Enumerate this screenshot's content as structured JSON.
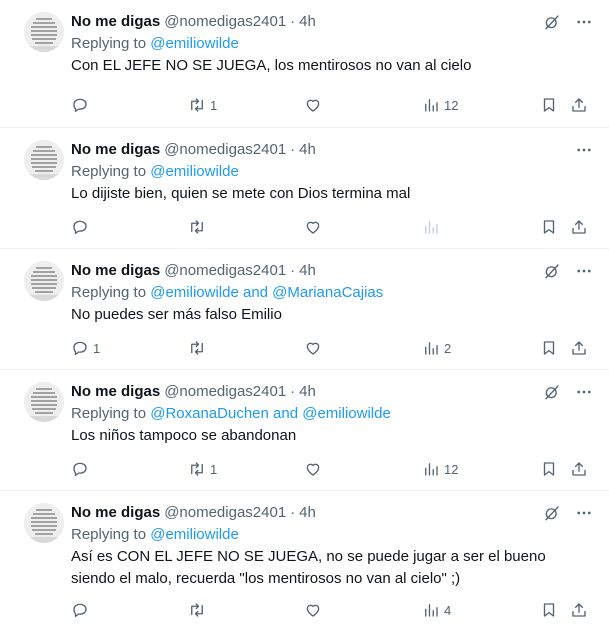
{
  "tweets": [
    {
      "name": "No me digas",
      "handle": "@nomedigas2401",
      "time": "4h",
      "replying_prefix": "Replying to ",
      "mentions": "@emiliowilde",
      "text": "Con EL JEFE NO SE JUEGA, los mentirosos no van al cielo",
      "reply_count": "",
      "retweet_count": "1",
      "like_count": "",
      "views_count": "12",
      "has_grok": true
    },
    {
      "name": "No me digas",
      "handle": "@nomedigas2401",
      "time": "4h",
      "replying_prefix": "Replying to ",
      "mentions": "@emiliowilde",
      "text": "Lo dijiste bien, quien se mete con Dios termina mal",
      "reply_count": "",
      "retweet_count": "",
      "like_count": "",
      "views_count": "",
      "has_grok": false
    },
    {
      "name": "No me digas",
      "handle": "@nomedigas2401",
      "time": "4h",
      "replying_prefix": "Replying to ",
      "mentions": "@emiliowilde and @MarianaCajias",
      "text": "No puedes ser más falso Emilio",
      "reply_count": "1",
      "retweet_count": "",
      "like_count": "",
      "views_count": "2",
      "has_grok": true
    },
    {
      "name": "No me digas",
      "handle": "@nomedigas2401",
      "time": "4h",
      "replying_prefix": "Replying to ",
      "mentions": "@RoxanaDuchen and @emiliowilde",
      "text": "Los niños tampoco se abandonan",
      "reply_count": "",
      "retweet_count": "1",
      "like_count": "",
      "views_count": "12",
      "has_grok": true
    },
    {
      "name": "No me digas",
      "handle": "@nomedigas2401",
      "time": "4h",
      "replying_prefix": "Replying to ",
      "mentions": "@emiliowilde",
      "text": "Así es CON EL JEFE NO SE JUEGA, no se puede jugar a ser el bueno siendo el malo, recuerda \"los mentirosos no van al cielo\" ;)",
      "reply_count": "",
      "retweet_count": "",
      "like_count": "",
      "views_count": "4",
      "has_grok": true
    }
  ],
  "dot": "·",
  "colors": {
    "link": "#1d9bf0",
    "secondary": "#536471",
    "primary": "#0f1419",
    "divider": "#eff3f4"
  },
  "icons": [
    "grok-icon",
    "more-icon",
    "reply-icon",
    "retweet-icon",
    "like-icon",
    "views-icon",
    "bookmark-icon",
    "share-icon"
  ]
}
